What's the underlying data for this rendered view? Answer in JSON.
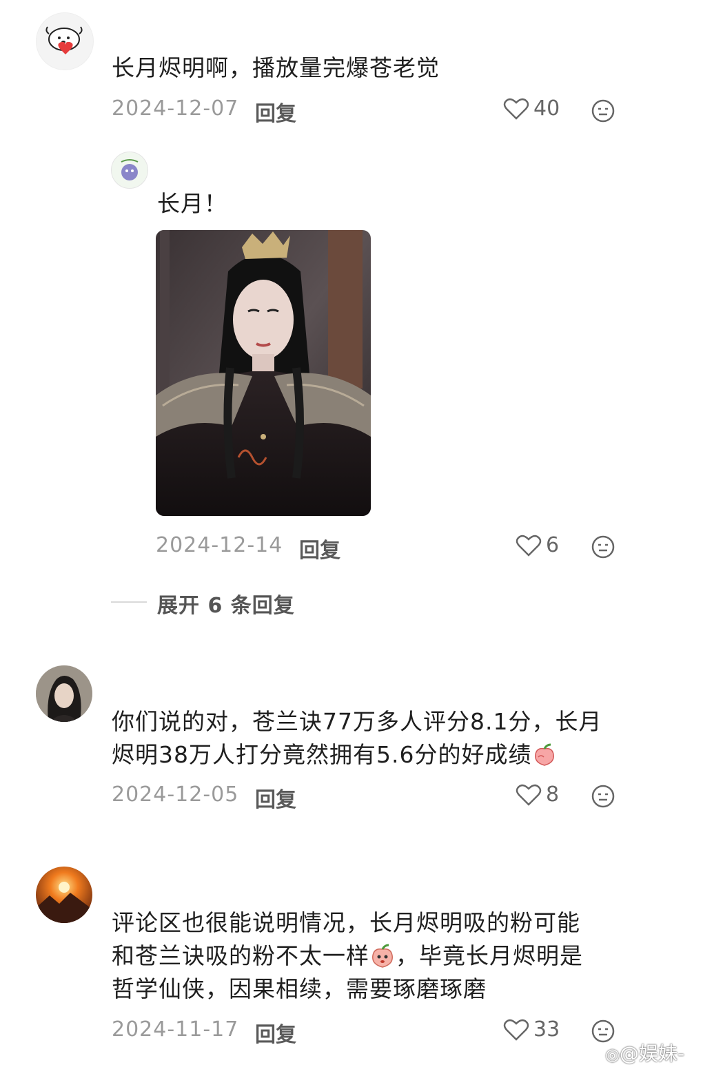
{
  "comments": [
    {
      "text": "长月烬明啊，播放量完爆苍老觉",
      "date": "2024-12-07",
      "reply_label": "回复",
      "likes": "40",
      "avatar_icon": "dog-heart-avatar",
      "replies": [
        {
          "text": "长月！",
          "image": "costume-drama-character-photo",
          "date": "2024-12-14",
          "reply_label": "回复",
          "likes": "6",
          "avatar_icon": "purple-creature-avatar"
        }
      ],
      "expand_label": "展开 6 条回复"
    },
    {
      "text_line1": "你们说的对，苍兰诀77万多人评分8.1分，长月",
      "text_line2": "烬明38万人打分竟然拥有5.6分的好成绩",
      "text_emoji": "peach-emoji",
      "date": "2024-12-05",
      "reply_label": "回复",
      "likes": "8",
      "avatar_icon": "woman-portrait-avatar"
    },
    {
      "text_line1": "评论区也很能说明情况，长月烬明吸的粉可能",
      "text_line2a": "和苍兰诀吸的粉不太一样",
      "text_line2b": "，毕竟长月烬明是",
      "text_line3": "哲学仙侠，因果相续，需要琢磨琢磨",
      "text_emoji": "peach-face-emoji",
      "date": "2024-11-17",
      "reply_label": "回复",
      "likes": "33",
      "avatar_icon": "sunset-mountain-avatar"
    }
  ],
  "watermark": "@娱妹-"
}
